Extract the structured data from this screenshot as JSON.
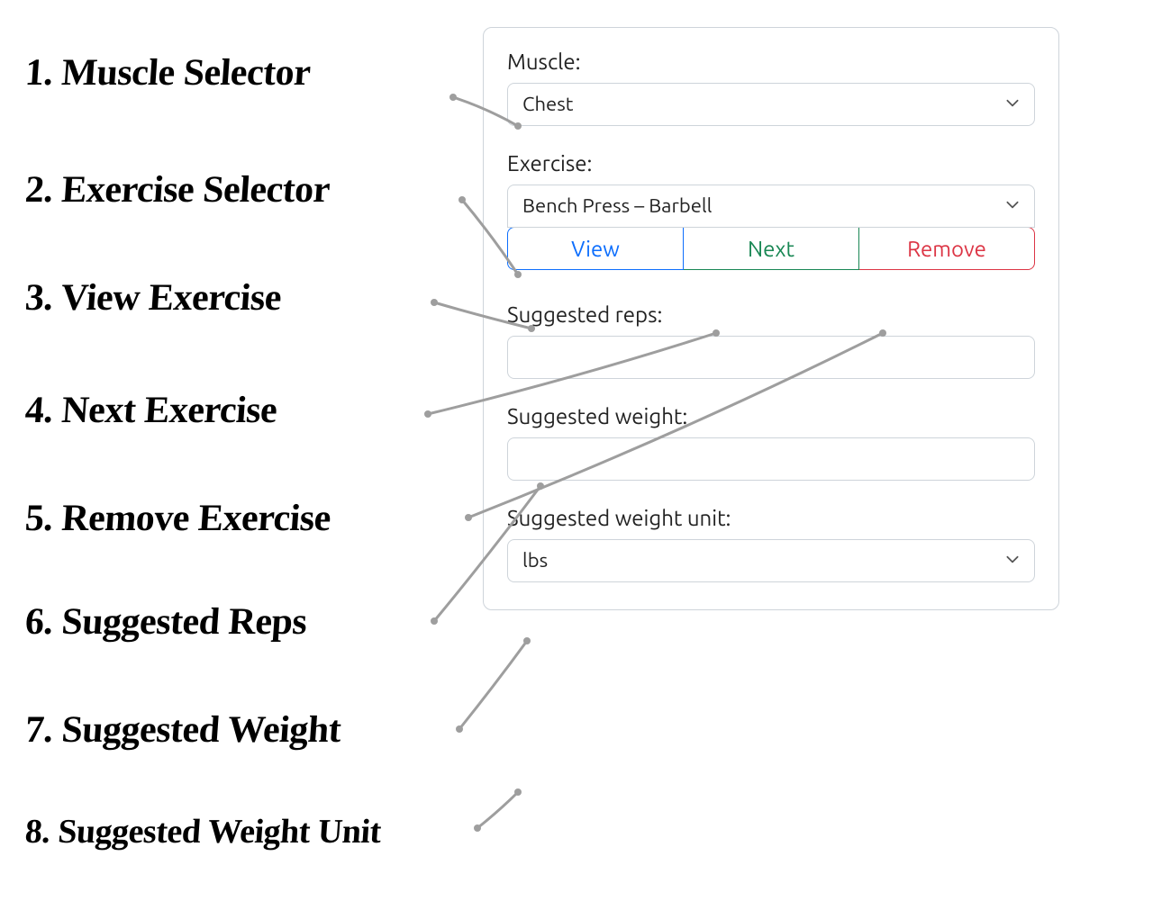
{
  "annotations": [
    {
      "n": "1.",
      "text": "Muscle Selector"
    },
    {
      "n": "2.",
      "text": "Exercise Selector"
    },
    {
      "n": "3.",
      "text": "View Exercise"
    },
    {
      "n": "4.",
      "text": "Next Exercise"
    },
    {
      "n": "5.",
      "text": "Remove Exercise"
    },
    {
      "n": "6.",
      "text": "Suggested Reps"
    },
    {
      "n": "7.",
      "text": "Suggested Weight"
    },
    {
      "n": "8.",
      "text": "Suggested Weight Unit"
    }
  ],
  "form": {
    "muscle": {
      "label": "Muscle:",
      "value": "Chest"
    },
    "exercise": {
      "label": "Exercise:",
      "value": "Bench Press – Barbell"
    },
    "buttons": {
      "view": "View",
      "next": "Next",
      "remove": "Remove"
    },
    "reps": {
      "label": "Suggested reps:",
      "value": ""
    },
    "weight": {
      "label": "Suggested weight:",
      "value": ""
    },
    "unit": {
      "label": "Suggested weight unit:",
      "value": "lbs"
    }
  },
  "colors": {
    "view": "#0d6efd",
    "next": "#198754",
    "remove": "#dc3545",
    "border": "#ced4da",
    "leader": "#9e9e9e"
  }
}
